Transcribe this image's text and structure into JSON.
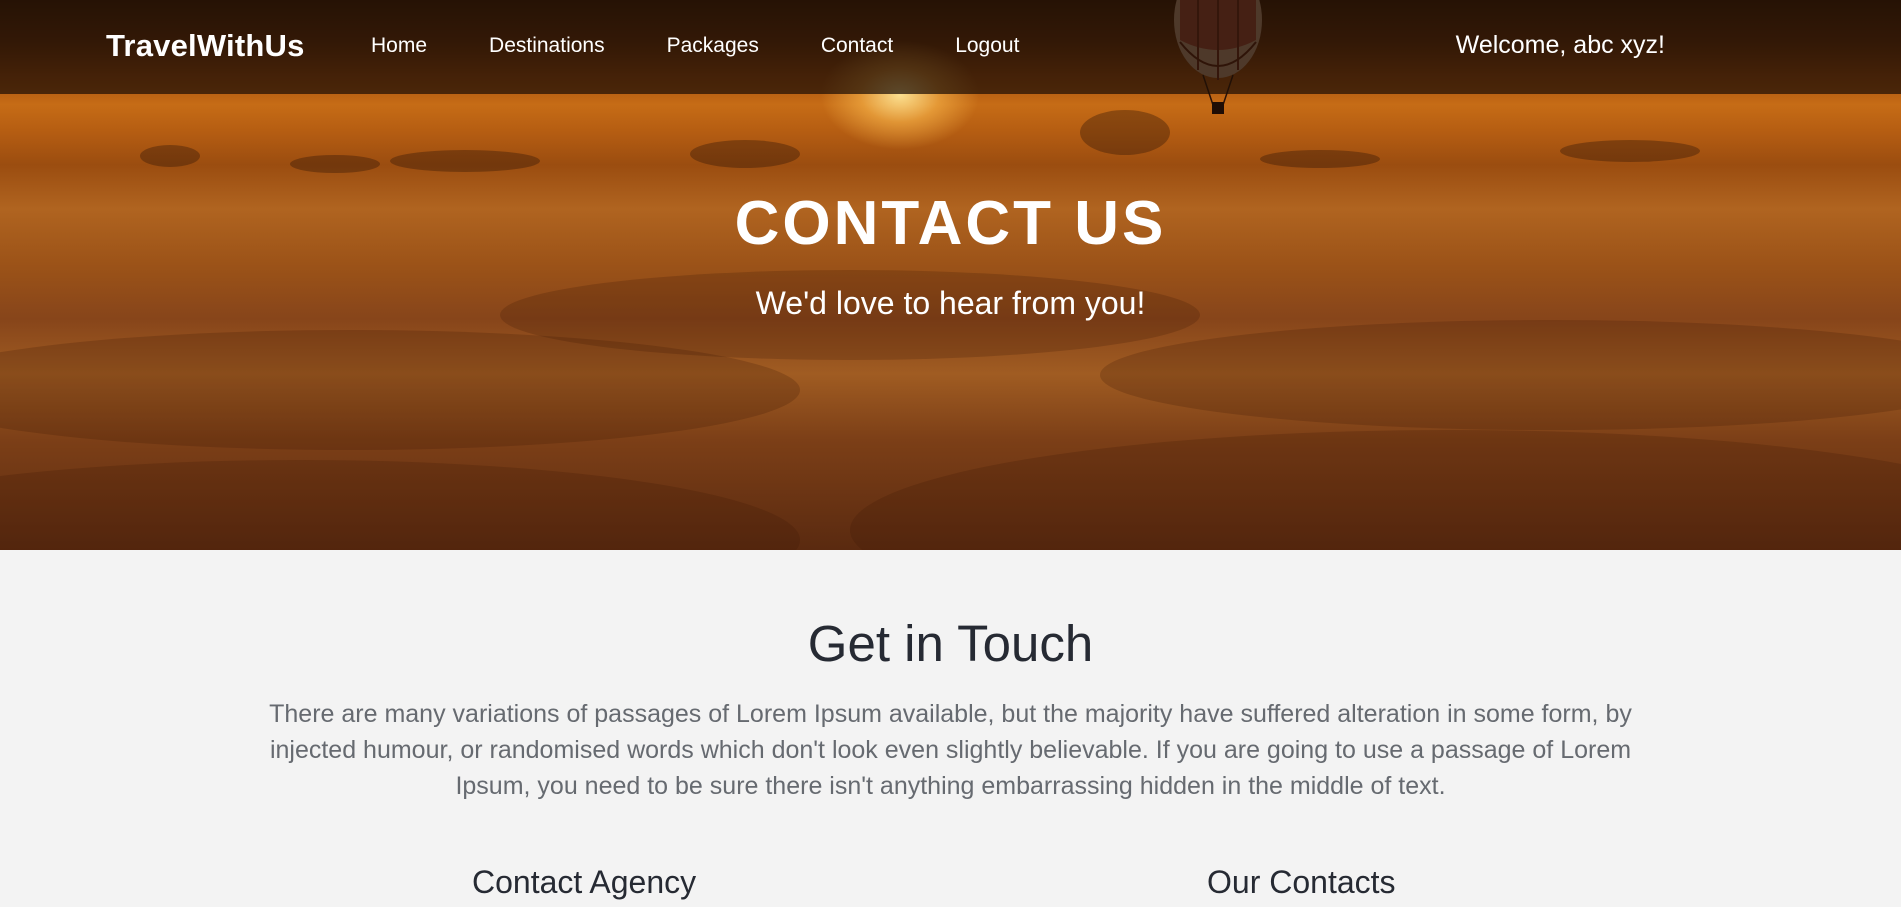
{
  "navbar": {
    "brand": "TravelWithUs",
    "links": [
      "Home",
      "Destinations",
      "Packages",
      "Contact",
      "Logout"
    ],
    "welcome": "Welcome, abc xyz!"
  },
  "hero": {
    "title": "CONTACT US",
    "subtitle": "We'd love to hear from you!"
  },
  "main": {
    "title": "Get in Touch",
    "description": "There are many variations of passages of Lorem Ipsum available, but the majority have suffered alteration in some form, by injected humour, or randomised words which don't look even slightly believable. If you are going to use a passage of Lorem Ipsum, you need to be sure there isn't anything embarrassing hidden in the middle of text.",
    "columns": [
      "Contact Agency",
      "Our Contacts"
    ]
  },
  "colors": {
    "hero_background": "#a8520f",
    "navbar_background": "#1e0f05",
    "content_background": "#f3f3f3",
    "heading_text": "#262a33",
    "body_text": "#666a70"
  }
}
